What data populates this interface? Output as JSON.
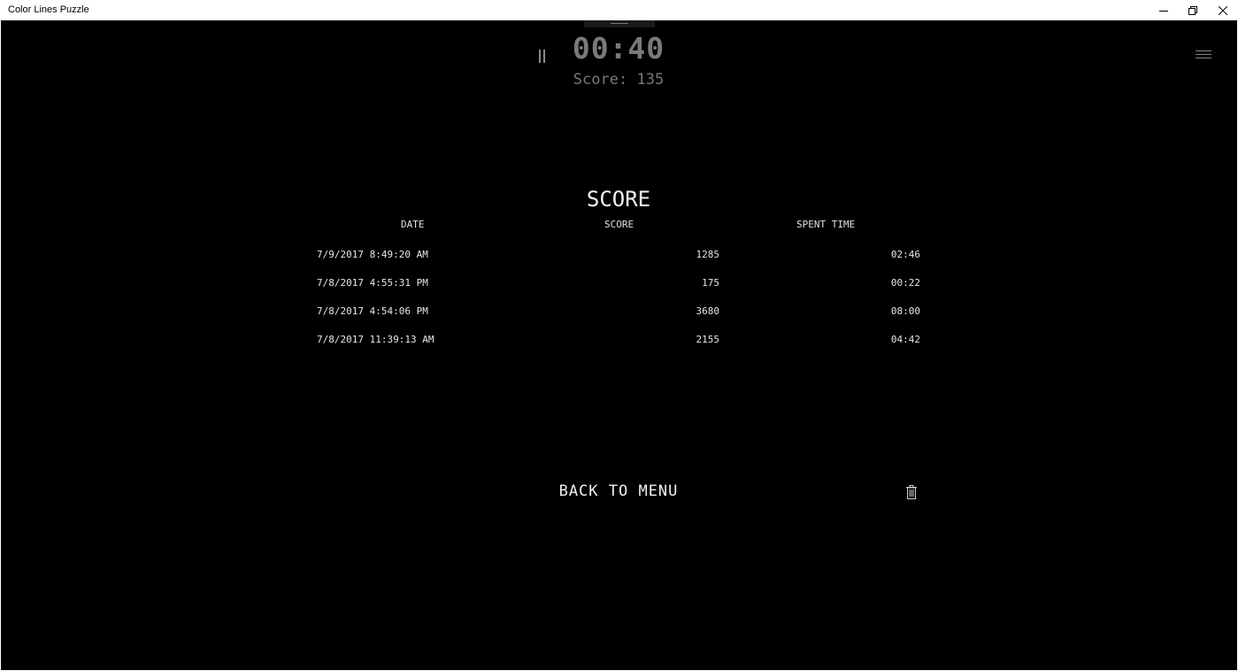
{
  "window": {
    "title": "Color Lines Puzzle"
  },
  "game": {
    "timer": "00:40",
    "score_label": "Score:",
    "score_value": "135"
  },
  "scores": {
    "heading": "SCORE",
    "columns": [
      "DATE",
      "SCORE",
      "SPENT TIME"
    ],
    "rows": [
      {
        "date": "7/9/2017 8:49:20 AM",
        "score": "1285",
        "time": "02:46"
      },
      {
        "date": "7/8/2017 4:55:31 PM",
        "score": "175",
        "time": "00:22"
      },
      {
        "date": "7/8/2017 4:54:06 PM",
        "score": "3680",
        "time": "08:00"
      },
      {
        "date": "7/8/2017 11:39:13 AM",
        "score": "2155",
        "time": "04:42"
      }
    ]
  },
  "actions": {
    "back_label": "BACK TO MENU"
  },
  "icons": {
    "pause": "pause-icon",
    "menu": "hamburger-menu-icon",
    "delete": "trash-icon",
    "minimize": "minimize-icon",
    "restore": "restore-icon",
    "close": "close-icon"
  },
  "colors": {
    "background": "#000000",
    "text": "#f0f0f0",
    "muted": "#7a7a7a"
  }
}
